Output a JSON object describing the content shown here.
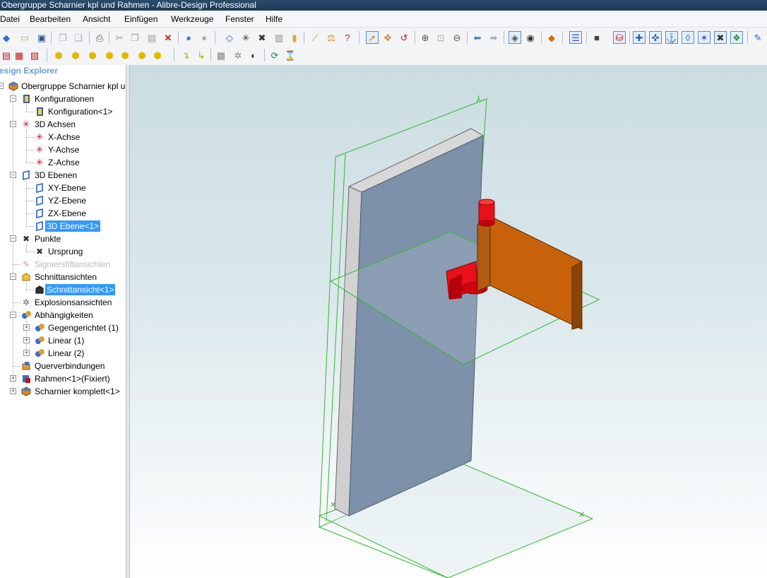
{
  "window": {
    "title": "Obergruppe Scharnier kpl und Rahmen - Alibre-Design Professional"
  },
  "menu": {
    "items": [
      "Datei",
      "Bearbeiten",
      "Ansicht",
      "Einfügen",
      "Werkzeuge",
      "Fenster",
      "Hilfe"
    ]
  },
  "design_explorer": {
    "title": "Design Explorer",
    "root": "Obergruppe Scharnier kpl und Rahmen",
    "nodes": {
      "konfigurationen": "Konfigurationen",
      "konfiguration1": "Konfiguration<1>",
      "achsen": "3D Achsen",
      "x_achse": "X-Achse",
      "y_achse": "Y-Achse",
      "z_achse": "Z-Achse",
      "ebenen": "3D Ebenen",
      "xy_ebene": "XY-Ebene",
      "yz_ebene": "YZ-Ebene",
      "zx_ebene": "ZX-Ebene",
      "ebene1": "3D Ebene<1>",
      "punkte": "Punkte",
      "ursprung": "Ursprung",
      "signierstift": "Signierstiftansichten",
      "schnittansichten": "Schnittansichten",
      "schnittansicht1": "Schnittansicht<1>",
      "explosion": "Explosionsansichten",
      "abhaengigkeiten": "Abhängigkeiten",
      "gegengerichtet": "Gegengerichtet (1)",
      "linear1": "Linear (1)",
      "linear2": "Linear (2)",
      "querverbindungen": "Querverbindungen",
      "rahmen": "Rahmen<1>(Fixiert)",
      "scharnier": "Scharnier komplett<1>"
    },
    "selected": [
      "3D Ebene<1>",
      "Schnittansicht<1>"
    ]
  },
  "colors": {
    "selection": "#3399ff",
    "door_face": "#7d91aa",
    "door_edge": "#d8d8d8",
    "hinge_leaf": "#c8620a",
    "hinge_pin": "#e8101a",
    "plane_lines": "#2fb52f"
  },
  "toolbar_icons": {
    "row1": [
      "new-icon",
      "open-icon",
      "save-icon",
      "copy-doc-icon",
      "paste-doc-icon",
      "print-icon",
      "cut-icon",
      "copy-icon",
      "paste-icon",
      "delete-icon",
      "back-icon",
      "forward-icon",
      "plane-icon",
      "axis-icon",
      "point-icon",
      "part-icon",
      "assembly-icon",
      "measure-icon",
      "balance-icon",
      "info-icon",
      "select-icon",
      "move-icon",
      "rotate-icon",
      "zoom-in-icon",
      "zoom-window-icon",
      "zoom-out-icon",
      "prev-view-icon",
      "next-view-icon",
      "shaded-icon",
      "hidden-lines-icon",
      "render-icon",
      "explorer-icon",
      "solid-icon",
      "constraint-icon",
      "mate-icon",
      "align-icon",
      "orient-icon",
      "tangent-icon",
      "angle-icon",
      "fix-icon",
      "analyze-icon",
      "more-icon"
    ],
    "row2": [
      "drawing-icon",
      "bom-icon",
      "report-icon",
      "view-front-icon",
      "view-back-icon",
      "view-left-icon",
      "view-right-icon",
      "view-top-icon",
      "view-bottom-icon",
      "view-iso-icon",
      "flip-icon",
      "flip2-icon",
      "section-icon",
      "explode-icon",
      "animate-icon",
      "refresh-icon",
      "clear-icon"
    ]
  }
}
